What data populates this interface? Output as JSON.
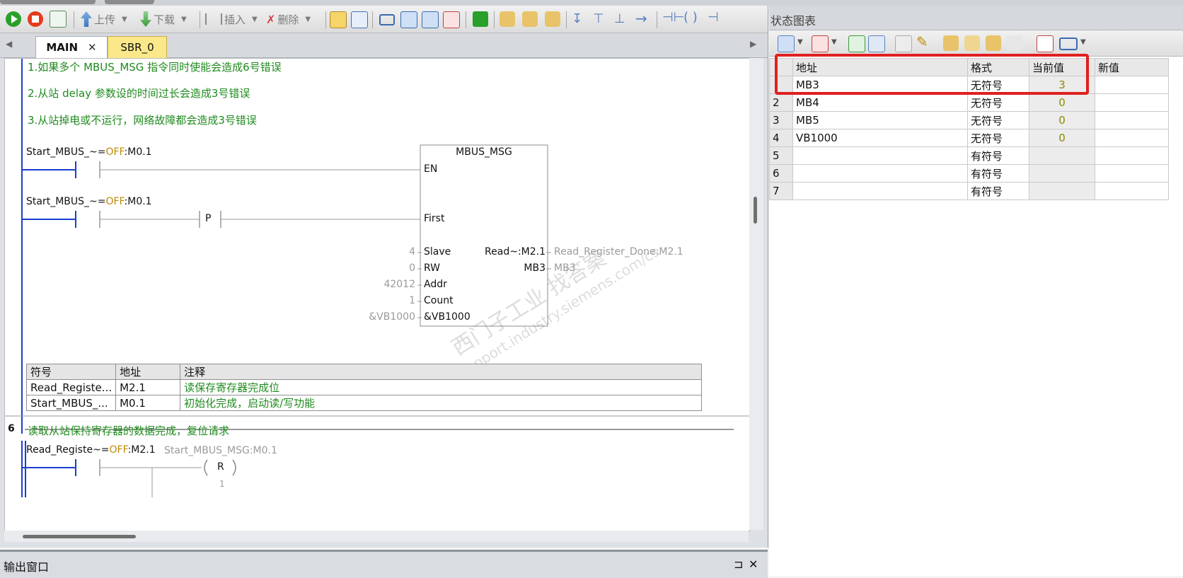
{
  "toolbar": {
    "upload_label": "上传",
    "download_label": "下载",
    "insert_label": "插入",
    "delete_label": "删除"
  },
  "tabs": [
    {
      "label": "MAIN",
      "close": "✕"
    },
    {
      "label": "SBR_0"
    }
  ],
  "comments": [
    "1.如果多个 MBUS_MSG 指令同时使能会造成6号错误",
    "2.从站 delay 参数设的时间过长会造成3号错误",
    "3.从站掉电或不运行，网络故障都会造成3号错误"
  ],
  "network5": {
    "contact1": {
      "name": "Start_MBUS_~",
      "eq": "=",
      "state": "OFF",
      "addr": ":M0.1"
    },
    "contact2": {
      "name": "Start_MBUS_~",
      "eq": "=",
      "state": "OFF",
      "addr": ":M0.1"
    },
    "p_label": "P",
    "block": {
      "title": "MBUS_MSG",
      "en": "EN",
      "first": "First",
      "inputs": [
        {
          "value": "4",
          "pin": "Slave"
        },
        {
          "value": "0",
          "pin": "RW"
        },
        {
          "value": "42012",
          "pin": "Addr"
        },
        {
          "value": "1",
          "pin": "Count"
        },
        {
          "value": "&VB1000",
          "pin": "&VB1000"
        }
      ],
      "outputs": [
        {
          "pin": "Read~:M2.1",
          "value": "Read_Register_Done:M2.1"
        },
        {
          "pin": "MB3",
          "value": "MB3"
        }
      ]
    }
  },
  "symbol_table": {
    "headers": [
      "符号",
      "地址",
      "注释"
    ],
    "rows": [
      [
        "Read_Registe...",
        "M2.1",
        "读保存寄存器完成位"
      ],
      [
        "Start_MBUS_...",
        "M0.1",
        "初始化完成，启动读/写功能"
      ]
    ]
  },
  "network6": {
    "number": "6",
    "comment": "读取从站保持寄存器的数据完成，复位请求",
    "contact": {
      "name": "Read_Registe~",
      "eq": "=",
      "state": "OFF",
      "addr": ":M2.1"
    },
    "coil_target": "Start_MBUS_MSG:M0.1",
    "coil_label": "R",
    "coil_count": "1"
  },
  "output_window": {
    "title": "输出窗口",
    "pin": "⊐",
    "close": "✕"
  },
  "status_chart": {
    "title": "状态图表",
    "headers": [
      "地址",
      "格式",
      "当前值",
      "新值"
    ],
    "rows": [
      {
        "num": "",
        "addr": "MB3",
        "fmt": "无符号",
        "cur": "3",
        "new": ""
      },
      {
        "num": "2",
        "addr": "MB4",
        "fmt": "无符号",
        "cur": "0",
        "new": ""
      },
      {
        "num": "3",
        "addr": "MB5",
        "fmt": "无符号",
        "cur": "0",
        "new": ""
      },
      {
        "num": "4",
        "addr": "VB1000",
        "fmt": "无符号",
        "cur": "0",
        "new": ""
      },
      {
        "num": "5",
        "addr": "",
        "fmt": "有符号",
        "cur": "",
        "new": ""
      },
      {
        "num": "6",
        "addr": "",
        "fmt": "有符号",
        "cur": "",
        "new": ""
      },
      {
        "num": "7",
        "addr": "",
        "fmt": "有符号",
        "cur": "",
        "new": ""
      }
    ]
  },
  "watermark": "西门子工业 找答案 support.industry.siemens.com/cs",
  "colors": {
    "highlight": "#e02020",
    "comment": "#1f8a1f",
    "off": "#c08a00",
    "power_rail": "#1a3fd0"
  }
}
